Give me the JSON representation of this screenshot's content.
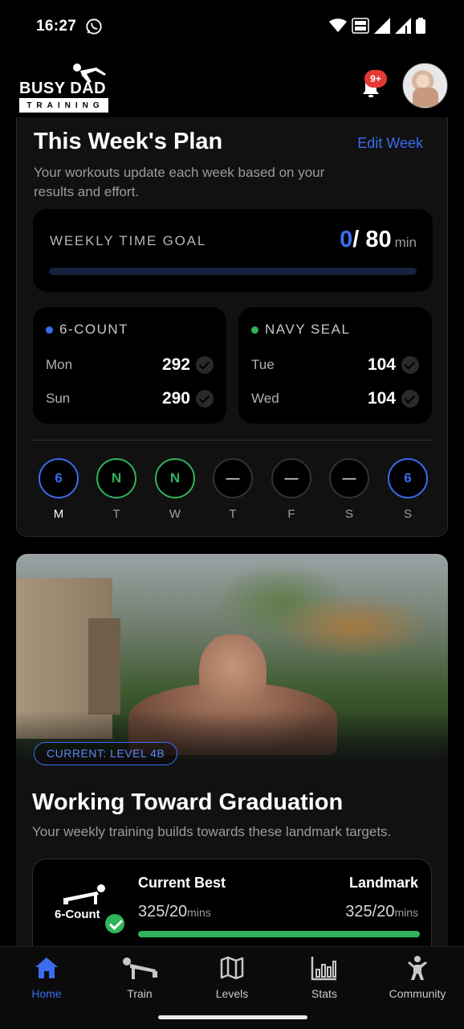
{
  "status_bar": {
    "time": "16:27"
  },
  "header": {
    "logo_text": "BUSY DAD",
    "logo_sub": "TRAINING",
    "notification_badge": "9+"
  },
  "plan": {
    "title": "This Week's Plan",
    "edit_label": "Edit Week",
    "subtitle": "Your workouts update each week based on your results and effort.",
    "goal_label": "WEEKLY TIME GOAL",
    "goal_current": "0",
    "goal_total": "/ 80",
    "goal_unit": "min",
    "goal_progress": 0,
    "programs": [
      {
        "name": "6-COUNT",
        "color": "#3b6cf0",
        "rows": [
          {
            "day": "Mon",
            "value": "292"
          },
          {
            "day": "Sun",
            "value": "290"
          }
        ]
      },
      {
        "name": "NAVY SEAL",
        "color": "#2fb35a",
        "rows": [
          {
            "day": "Tue",
            "value": "104"
          },
          {
            "day": "Wed",
            "value": "104"
          }
        ]
      }
    ],
    "week": [
      {
        "mark": "6",
        "day": "M",
        "type": "six"
      },
      {
        "mark": "N",
        "day": "T",
        "type": "navy"
      },
      {
        "mark": "N",
        "day": "W",
        "type": "navy"
      },
      {
        "mark": "—",
        "day": "T",
        "type": "rest"
      },
      {
        "mark": "—",
        "day": "F",
        "type": "rest"
      },
      {
        "mark": "—",
        "day": "S",
        "type": "rest"
      },
      {
        "mark": "6",
        "day": "S",
        "type": "six"
      }
    ]
  },
  "level": {
    "pill": "CURRENT: LEVEL 4B",
    "title": "Working Toward Graduation",
    "subtitle": "Your weekly training builds towards these landmark targets.",
    "landmark": {
      "exercise": "6-Count",
      "current_label": "Current Best",
      "current_value": "325/20",
      "current_unit": "mins",
      "target_label": "Landmark",
      "target_value": "325/20",
      "target_unit": "mins",
      "progress": 1.0
    }
  },
  "nav": {
    "items": [
      {
        "label": "Home",
        "icon": "home-icon"
      },
      {
        "label": "Train",
        "icon": "pushup-icon"
      },
      {
        "label": "Levels",
        "icon": "map-icon"
      },
      {
        "label": "Stats",
        "icon": "stats-icon"
      },
      {
        "label": "Community",
        "icon": "community-icon"
      }
    ]
  },
  "colors": {
    "accent": "#3b6cf0",
    "success": "#2fb35a",
    "background": "#000000",
    "card": "#111112"
  }
}
